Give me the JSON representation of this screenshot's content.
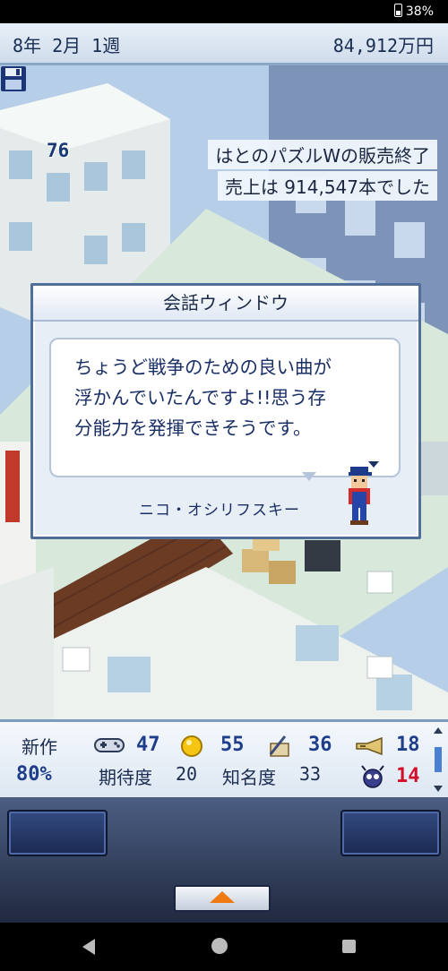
{
  "status_bar": {
    "battery": "38%"
  },
  "top_bar": {
    "date": "8年 2月 1週",
    "funds": "84,912万円"
  },
  "hud": {
    "save_count": "76"
  },
  "news": {
    "line1": "はとのパズルWの販売終了",
    "line2": "売上は 914,547本でした"
  },
  "dialog": {
    "title": "会話ウィンドウ",
    "message_line1": "ちょうど戦争のための良い曲が",
    "message_line2": "浮かんでいたんですよ!!思う存",
    "message_line3": "分能力を発揮できそうです。",
    "speaker": "ニコ・オシリフスキー"
  },
  "stats": {
    "label_new_work": "新作",
    "progress": "80%",
    "controller_val": "47",
    "coin_val": "55",
    "scenario_val": "36",
    "sound_val": "18",
    "label_expectation": "期待度",
    "expectation_val": "20",
    "label_fame": "知名度",
    "fame_val": "33",
    "bug_val": "14"
  },
  "colors": {
    "accent": "#1e3e8c",
    "alert": "#d1102a",
    "expand_arrow": "#ef7a14"
  }
}
